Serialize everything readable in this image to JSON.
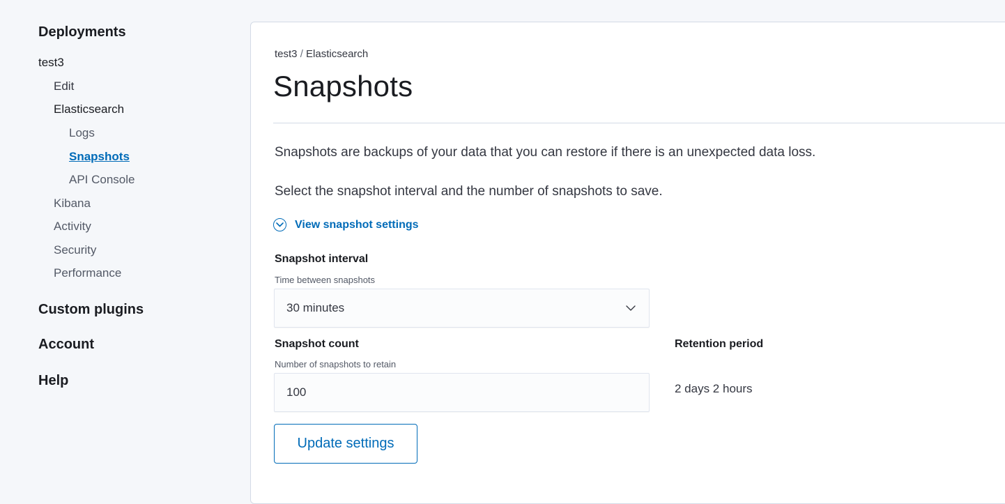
{
  "sidebar": {
    "deployments": "Deployments",
    "deployment_name": "test3",
    "items": {
      "edit": "Edit",
      "elasticsearch": "Elasticsearch",
      "logs": "Logs",
      "snapshots": "Snapshots",
      "api_console": "API Console",
      "kibana": "Kibana",
      "activity": "Activity",
      "security": "Security",
      "performance": "Performance"
    },
    "custom_plugins": "Custom plugins",
    "account": "Account",
    "help": "Help"
  },
  "breadcrumb": {
    "deployment": "test3",
    "separator": "/",
    "section": "Elasticsearch"
  },
  "page_title": "Snapshots",
  "description": "Snapshots are backups of your data that you can restore if there is an unexpected data loss.",
  "instruction": "Select the snapshot interval and the number of snapshots to save.",
  "settings_toggle": {
    "label": "View snapshot settings",
    "icon": "chevron-down-icon"
  },
  "interval": {
    "label": "Snapshot interval",
    "help": "Time between snapshots",
    "value": "30 minutes"
  },
  "count": {
    "label": "Snapshot count",
    "help": "Number of snapshots to retain",
    "value": "100"
  },
  "retention": {
    "label": "Retention period",
    "value": "2 days 2 hours"
  },
  "update_button": "Update settings",
  "colors": {
    "accent": "#006bb8",
    "text": "#343741",
    "page_background": "#f5f7fa",
    "border": "#d3dae6"
  }
}
